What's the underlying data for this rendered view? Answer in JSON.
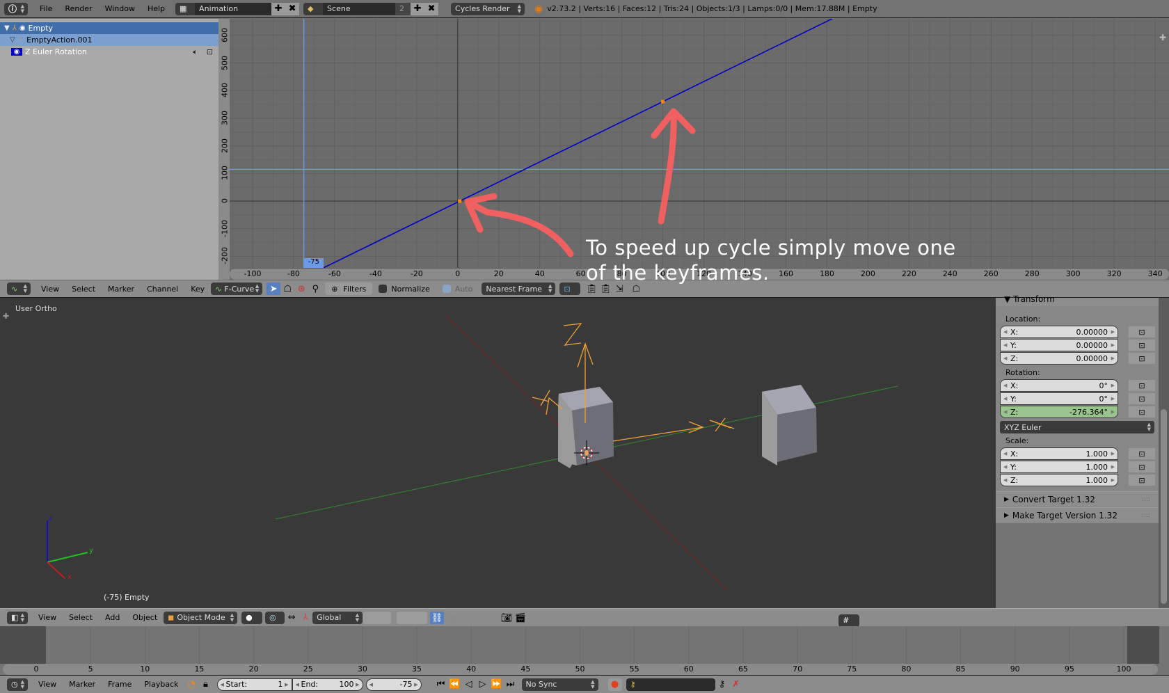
{
  "topbar": {
    "menus": [
      "File",
      "Render",
      "Window",
      "Help"
    ],
    "screen_layout": "Animation",
    "scene": "Scene",
    "scene_users": "2",
    "render_engine": "Cycles Render",
    "stats": "v2.73.2 | Verts:16 | Faces:12 | Tris:24 | Objects:1/3 | Lamps:0/0 | Mem:17.88M | Empty"
  },
  "channels": {
    "object": "Empty",
    "action": "EmptyAction.001",
    "fcurve": "Z Euler Rotation"
  },
  "graph": {
    "x_ticks": [
      -100,
      -80,
      -60,
      -40,
      -20,
      0,
      20,
      40,
      60,
      80,
      100,
      120,
      140,
      160,
      180,
      200,
      220,
      240,
      260,
      280,
      300,
      320,
      340
    ],
    "y_ticks": [
      -200,
      -100,
      0,
      100,
      200,
      300,
      400,
      500,
      600
    ],
    "current_frame": "-75",
    "cursor_value": 115,
    "curve_color": "#0000c8",
    "keyframes": [
      {
        "frame": 1,
        "value": 0
      },
      {
        "frame": 100,
        "value": 360
      }
    ],
    "annotation_line1": "To speed up cycle simply move one",
    "annotation_line2": "of the keyframes."
  },
  "graph_header": {
    "menus": [
      "View",
      "Select",
      "Marker",
      "Channel",
      "Key"
    ],
    "mode": "F-Curve",
    "filters_label": "Filters",
    "normalize_label": "Normalize",
    "auto_label": "Auto",
    "snap": "Nearest Frame"
  },
  "view3d": {
    "view_label": "User Ortho",
    "object_label": "(-75) Empty",
    "axis_labels": {
      "x": "x",
      "y": "y",
      "z": "z"
    }
  },
  "npanel": {
    "section": "Transform",
    "location_label": "Location:",
    "location": [
      {
        "axis": "X:",
        "value": "0.00000"
      },
      {
        "axis": "Y:",
        "value": "0.00000"
      },
      {
        "axis": "Z:",
        "value": "0.00000"
      }
    ],
    "rotation_label": "Rotation:",
    "rotation": [
      {
        "axis": "X:",
        "value": "0°"
      },
      {
        "axis": "Y:",
        "value": "0°"
      },
      {
        "axis": "Z:",
        "value": "-276.364°"
      }
    ],
    "rotation_mode": "XYZ Euler",
    "scale_label": "Scale:",
    "scale": [
      {
        "axis": "X:",
        "value": "1.000"
      },
      {
        "axis": "Y:",
        "value": "1.000"
      },
      {
        "axis": "Z:",
        "value": "1.000"
      }
    ],
    "subpanels": [
      "Convert Target 1.32",
      "Make Target  Version 1.32"
    ]
  },
  "view3d_header": {
    "menus": [
      "View",
      "Select",
      "Add",
      "Object"
    ],
    "mode": "Object Mode",
    "orientation": "Global"
  },
  "timeline": {
    "ticks": [
      0,
      5,
      10,
      15,
      20,
      25,
      30,
      35,
      40,
      45,
      50,
      55,
      60,
      65,
      70,
      75,
      80,
      85,
      90,
      95,
      100
    ],
    "menus": [
      "View",
      "Marker",
      "Frame",
      "Playback"
    ],
    "start_label": "Start:",
    "start": "1",
    "end_label": "End:",
    "end": "100",
    "current": "-75",
    "sync": "No Sync"
  }
}
